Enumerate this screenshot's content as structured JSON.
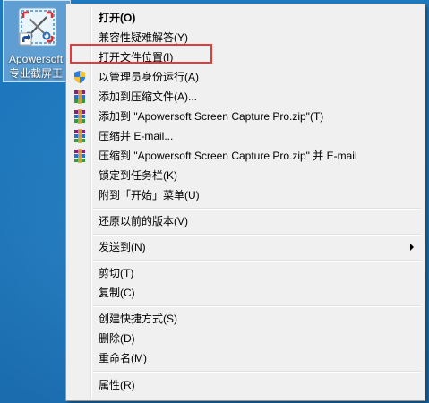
{
  "desktop": {
    "icon_label_line1": "Apowersoft",
    "icon_label_line2": "专业截屏王"
  },
  "menu": {
    "items": [
      {
        "label": "打开(O)"
      },
      {
        "label": "兼容性疑难解答(Y)"
      },
      {
        "label": "打开文件位置(I)"
      },
      {
        "label": "以管理员身份运行(A)"
      },
      {
        "label": "添加到压缩文件(A)..."
      },
      {
        "label": "添加到 \"Apowersoft Screen Capture Pro.zip\"(T)"
      },
      {
        "label": "压缩并 E-mail..."
      },
      {
        "label": "压缩到 \"Apowersoft Screen Capture Pro.zip\" 并 E-mail"
      },
      {
        "label": "锁定到任务栏(K)"
      },
      {
        "label": "附到「开始」菜单(U)"
      },
      {
        "label": "还原以前的版本(V)"
      },
      {
        "label": "发送到(N)"
      },
      {
        "label": "剪切(T)"
      },
      {
        "label": "复制(C)"
      },
      {
        "label": "创建快捷方式(S)"
      },
      {
        "label": "删除(D)"
      },
      {
        "label": "重命名(M)"
      },
      {
        "label": "属性(R)"
      }
    ]
  },
  "colors": {
    "highlight": "#e23b3b",
    "desktop": "#1e76ba",
    "menu_bg": "#f0f0f0"
  },
  "icons": {
    "app": "apowersoft-scissors-icon",
    "shortcut": "shortcut-arrow-icon",
    "admin": "uac-shield-icon",
    "archive": "winrar-books-icon",
    "submenu": "submenu-arrow-icon"
  }
}
